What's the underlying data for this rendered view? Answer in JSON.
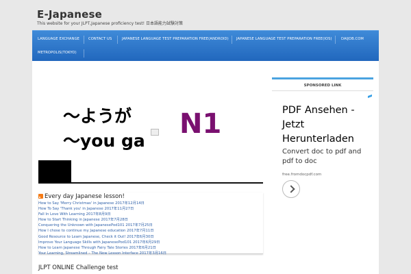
{
  "site": {
    "title": "E-Japanese",
    "tagline": "This website for your JLPT,Japanese proficiency test! 日本語能力試験対策"
  },
  "nav": {
    "items": [
      "LANGUAGE EXCHANGE",
      "CONTACT US",
      "JAPANESE LANGUAGE TEST PREPARATION FREE(ANDROID)",
      "JAPANESE LANGUAGE TEST PREPARATION FREE(IOS)",
      "DAIJOB.COM",
      "METROPOLIS(TOKYO)"
    ]
  },
  "featured": {
    "line1": "〜ようが",
    "line2": "〜you ga",
    "level": "N1"
  },
  "rss": {
    "heading": "Every day Japanese lesson!",
    "items": [
      "How to Say 'Merry Christmas' in Japanese 2017年12月14日",
      "How To Say 'Thank you' in Japanese 2017年11月27日",
      "Fall In Love With Learning 2017年8月9日",
      "How to Start Thinking in Japanese 2017年7月28日",
      "Conquering the Unknown with JapanesePod101 2017年7月25日",
      "How I chose to continue my Japanese education 2017年7月11日",
      "Good Resource to Learn Japanese, Check it Out! 2017年6月30日",
      "Improve Your Language Skills with JapanesePod101 2017年6月29日",
      "How to Learn Japanese Through Fairy Tale Stories 2017年6月21日",
      "Your Learning, Streamlined – The New Lesson Interface 2017年3月16日"
    ]
  },
  "jlpt": {
    "heading": "JLPT ONLINE Challenge test"
  },
  "sidebar": {
    "title": "SPONSORED LINK"
  },
  "ad": {
    "headline": "PDF Ansehen - Jetzt Herunterladen",
    "body": "Convert doc to pdf and pdf to doc",
    "url": "free.fromdocpdf.com"
  },
  "colors": {
    "nav_gradient_top": "#3f8ad8",
    "nav_gradient_bottom": "#2167bd",
    "n1_purple": "#7a1070",
    "link_blue": "#2b5ea8",
    "rss_orange": "#f57b17"
  }
}
